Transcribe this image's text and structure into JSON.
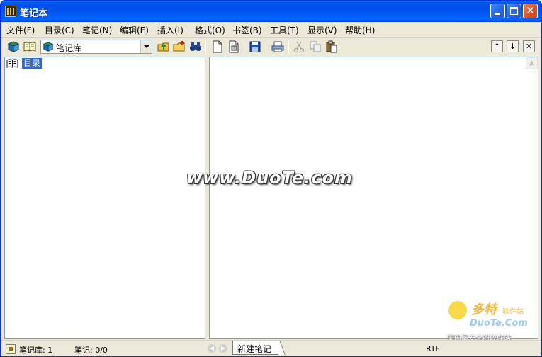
{
  "window": {
    "title": "笔记本"
  },
  "menu": [
    {
      "label": "文件(F)"
    },
    {
      "label": "目录(C)"
    },
    {
      "label": "笔记(N)"
    },
    {
      "label": "编辑(E)"
    },
    {
      "label": "插入(I)"
    },
    {
      "label": "格式(O)"
    },
    {
      "label": "书签(B)"
    },
    {
      "label": "工具(T)"
    },
    {
      "label": "显示(V)"
    },
    {
      "label": "帮助(H)"
    }
  ],
  "toolbar": {
    "library_select": {
      "value": "笔记库"
    },
    "icons_left": [
      "library-icon",
      "open-book-icon",
      "folder-up-icon",
      "new-folder-icon",
      "binoculars-icon"
    ],
    "icons_right": [
      "new-note-icon",
      "new-note-from-file-icon",
      "save-icon",
      "print-icon",
      "cut-icon",
      "copy-icon",
      "paste-icon",
      "move-up-icon",
      "move-down-icon",
      "close-icon"
    ]
  },
  "tree": {
    "root_label": "目录"
  },
  "watermark": "www.DuoTe.com",
  "logo": {
    "cn": "多特",
    "sub": "软件站",
    "en": "DuoTe.Com",
    "tagline": "国内最安全的软件站"
  },
  "status": {
    "library_count": "笔记库: 1",
    "note_count": "笔记: 0/0",
    "active_tab": "新建笔记",
    "format": "RTF"
  },
  "colors": {
    "titlebar": "#0053ee",
    "selection": "#316ac5",
    "chrome": "#ece9d8"
  }
}
